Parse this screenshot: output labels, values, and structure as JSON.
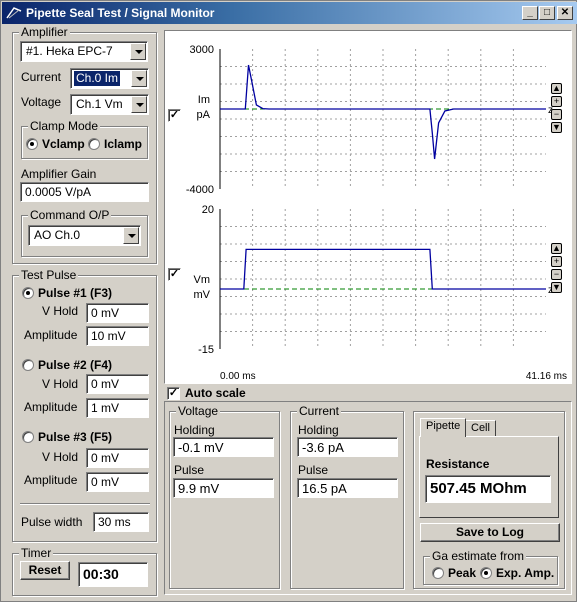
{
  "window": {
    "title": "Pipette Seal Test / Signal Monitor"
  },
  "amplifier": {
    "group_title": "Amplifier",
    "model": "#1. Heka EPC-7",
    "current_label": "Current",
    "current_channel": "Ch.0 Im",
    "voltage_label": "Voltage",
    "voltage_channel": "Ch.1 Vm",
    "clamp_mode_title": "Clamp Mode",
    "vclamp_label": "Vclamp",
    "iclamp_label": "Iclamp",
    "clamp_mode_selected": "Vclamp",
    "gain_label": "Amplifier Gain",
    "gain_value": "0.0005 V/pA",
    "command_title": "Command O/P",
    "command_value": "AO Ch.0"
  },
  "test_pulse": {
    "group_title": "Test Pulse",
    "selected": "Pulse #1 (F3)",
    "vhold_label": "V Hold",
    "amplitude_label": "Amplitude",
    "pulses": [
      {
        "label": "Pulse #1 (F3)",
        "vhold": "0 mV",
        "amplitude": "10 mV"
      },
      {
        "label": "Pulse #2 (F4)",
        "vhold": "0 mV",
        "amplitude": "1 mV"
      },
      {
        "label": "Pulse #3 (F5)",
        "vhold": "0 mV",
        "amplitude": "0 mV"
      }
    ],
    "pulse_width_label": "Pulse width",
    "pulse_width_value": "30 ms"
  },
  "timer": {
    "group_title": "Timer",
    "reset_label": "Reset",
    "value": "00:30"
  },
  "plots": {
    "top": {
      "y_max": "3000",
      "y_min": "-4000",
      "channel": "Im",
      "units": "pA",
      "zero_marker": "z"
    },
    "bottom": {
      "y_max": "20",
      "y_min": "-15",
      "channel": "Vm",
      "units": "mV",
      "zero_marker": "z"
    },
    "t_start": "0.00 ms",
    "t_end": "41.16 ms",
    "trace_color": "#0000a0",
    "zero_line_color": "#008000",
    "auto_scale_label": "Auto scale",
    "auto_scale_checked": true
  },
  "chart_data": [
    {
      "type": "line",
      "ylabel": "Im pA",
      "ylim": [
        -4000,
        3000
      ],
      "xlim": [
        0.0,
        41.16
      ],
      "series": [
        {
          "x": [
            0.0,
            3.2,
            3.6,
            4.0,
            4.6,
            5.4,
            6.2,
            26.5,
            26.8,
            27.1,
            27.6,
            28.4,
            29.5,
            41.16
          ],
          "y": [
            0,
            0,
            2200,
            1400,
            200,
            20,
            0,
            0,
            -1200,
            -2500,
            -700,
            -100,
            0,
            0
          ]
        }
      ]
    },
    {
      "type": "line",
      "ylabel": "Vm mV",
      "ylim": [
        -15,
        20
      ],
      "xlim": [
        0.0,
        41.16
      ],
      "series": [
        {
          "x": [
            0.0,
            3.0,
            3.3,
            26.5,
            26.8,
            41.16
          ],
          "y": [
            0,
            0,
            9.9,
            9.9,
            0,
            0
          ]
        }
      ]
    }
  ],
  "voltage": {
    "group_title": "Voltage",
    "holding_label": "Holding",
    "holding_value": "-0.1 mV",
    "pulse_label": "Pulse",
    "pulse_value": "9.9 mV"
  },
  "current": {
    "group_title": "Current",
    "holding_label": "Holding",
    "holding_value": "-3.6 pA",
    "pulse_label": "Pulse",
    "pulse_value": "16.5 pA"
  },
  "resistance": {
    "tabs": [
      "Pipette",
      "Cell"
    ],
    "active_tab": "Pipette",
    "label": "Resistance",
    "value": "507.45 MOhm",
    "save_label": "Save to Log",
    "ga_title": "Ga estimate from",
    "peak_label": "Peak",
    "exp_label": "Exp. Amp.",
    "ga_selected": "Exp. Amp."
  }
}
